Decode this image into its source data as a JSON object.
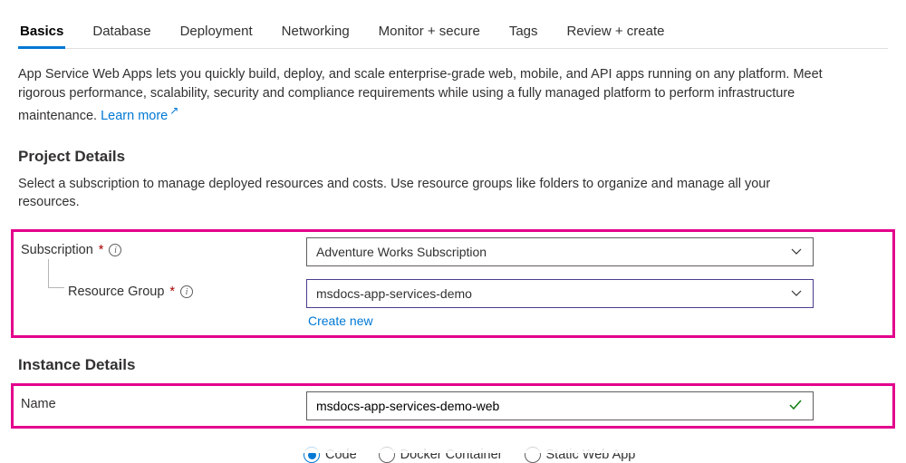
{
  "tabs": [
    "Basics",
    "Database",
    "Deployment",
    "Networking",
    "Monitor + secure",
    "Tags",
    "Review + create"
  ],
  "activeTab": "Basics",
  "intro": {
    "text": "App Service Web Apps lets you quickly build, deploy, and scale enterprise-grade web, mobile, and API apps running on any platform. Meet rigorous performance, scalability, security and compliance requirements while using a fully managed platform to perform infrastructure maintenance.  ",
    "learnMore": "Learn more"
  },
  "projectDetails": {
    "title": "Project Details",
    "desc": "Select a subscription to manage deployed resources and costs. Use resource groups like folders to organize and manage all your resources.",
    "subscription": {
      "label": "Subscription",
      "value": "Adventure Works Subscription"
    },
    "resourceGroup": {
      "label": "Resource Group",
      "value": "msdocs-app-services-demo",
      "createNew": "Create new"
    }
  },
  "instanceDetails": {
    "title": "Instance Details",
    "name": {
      "label": "Name",
      "value": "msdocs-app-services-demo-web"
    },
    "publishOptions": [
      "Code",
      "Docker Container",
      "Static Web App"
    ],
    "publishSelected": "Code"
  }
}
